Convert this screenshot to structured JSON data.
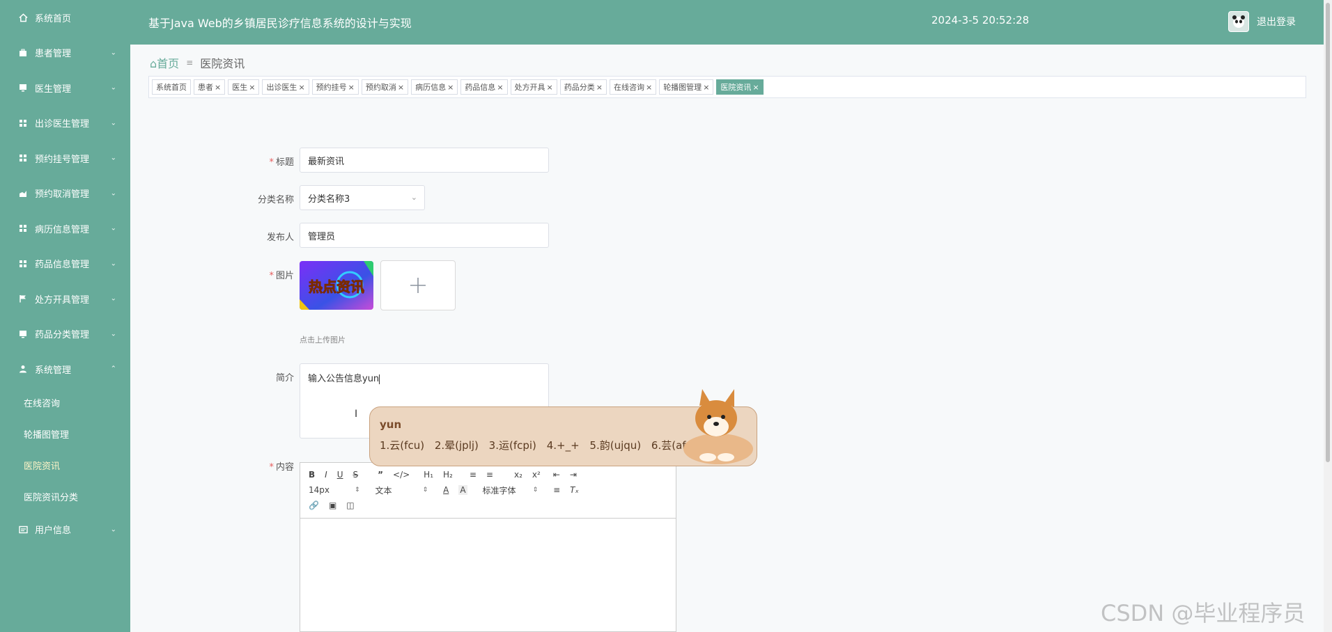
{
  "header": {
    "title": "基于Java Web的乡镇居民诊疗信息系统的设计与实现",
    "datetime": "2024-3-5 20:52:28",
    "logout": "退出登录"
  },
  "sidebar": {
    "items": [
      {
        "label": "系统首页",
        "icon": "home-icon"
      },
      {
        "label": "患者管理",
        "icon": "briefcase-icon"
      },
      {
        "label": "医生管理",
        "icon": "monitor-icon"
      },
      {
        "label": "出诊医生管理",
        "icon": "grid-icon"
      },
      {
        "label": "预约挂号管理",
        "icon": "grid-icon"
      },
      {
        "label": "预约取消管理",
        "icon": "chart-icon"
      },
      {
        "label": "病历信息管理",
        "icon": "grid-icon"
      },
      {
        "label": "药品信息管理",
        "icon": "grid-icon"
      },
      {
        "label": "处方开具管理",
        "icon": "flag-icon"
      },
      {
        "label": "药品分类管理",
        "icon": "monitor-icon"
      },
      {
        "label": "系统管理",
        "icon": "user-icon"
      }
    ],
    "subitems": [
      "在线咨询",
      "轮播图管理",
      "医院资讯",
      "医院资讯分类"
    ],
    "last": {
      "label": "用户信息",
      "icon": "card-icon"
    }
  },
  "breadcrumb": {
    "home": "首页",
    "current": "医院资讯"
  },
  "tabs": [
    "系统首页",
    "患者",
    "医生",
    "出诊医生",
    "预约挂号",
    "预约取消",
    "病历信息",
    "药品信息",
    "处方开具",
    "药品分类",
    "在线咨询",
    "轮播图管理",
    "医院资讯"
  ],
  "form": {
    "title_label": "标题",
    "title_value": "最新资讯",
    "category_label": "分类名称",
    "category_value": "分类名称3",
    "publisher_label": "发布人",
    "publisher_value": "管理员",
    "image_label": "图片",
    "image_text": "热点资讯",
    "upload_hint": "点击上传图片",
    "intro_label": "简介",
    "intro_value": "输入公告信息yun",
    "content_label": "内容"
  },
  "editor": {
    "font_size": "14px",
    "paragraph": "文本",
    "font_family": "标准字体"
  },
  "ime": {
    "typed": "yun",
    "candidates": [
      "1.云(fcu)",
      "2.晕(jplj)",
      "3.运(fcpi)",
      "4.+_+",
      "5.韵(ujqu)",
      "6.芸(afcu)"
    ]
  },
  "watermark": "CSDN @毕业程序员",
  "colors": {
    "primary": "#67ab9a",
    "required": "#e65c5c"
  }
}
